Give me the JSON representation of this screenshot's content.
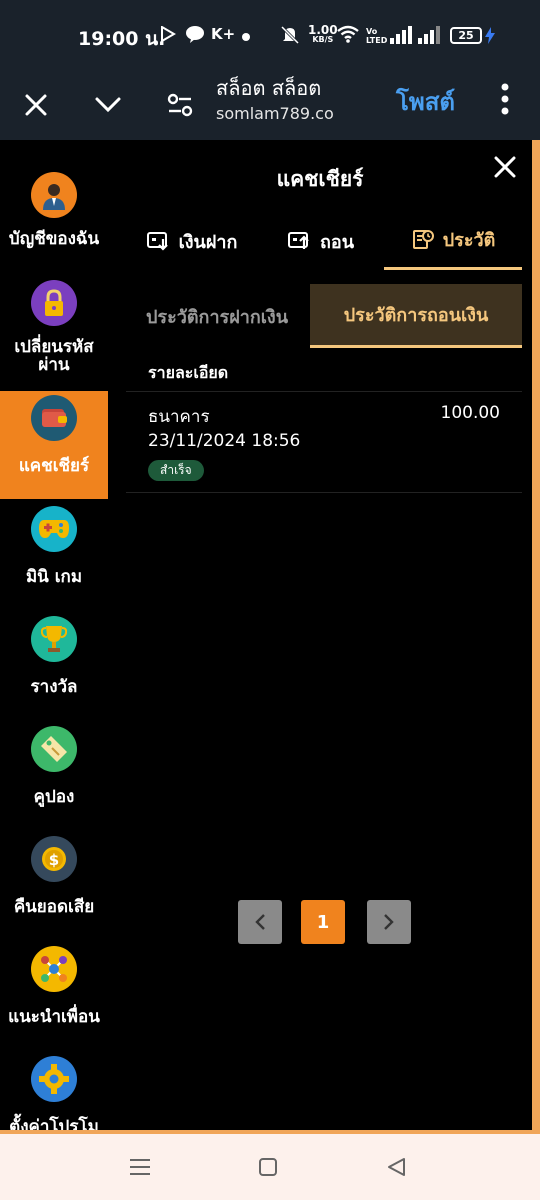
{
  "status_bar": {
    "time": "19:00 น.",
    "speed_value": "1.00",
    "speed_unit": "KB/S",
    "vo_top": "Vo",
    "vo_bottom": "LTED",
    "battery": "25",
    "k_plus": "K+"
  },
  "browser": {
    "title": "สล็อต สล็อต",
    "url": "somlam789.co",
    "post_label": "โพสต์"
  },
  "sidebar": {
    "items": [
      {
        "label": "บัญชีของฉัน",
        "icon": "user-icon",
        "color": "#f0831e"
      },
      {
        "label": "เปลี่ยนรหัสผ่าน",
        "icon": "lock-icon",
        "color": "#7b3fbf"
      },
      {
        "label": "แคชเชียร์",
        "icon": "wallet-icon",
        "color": "#1f5a73",
        "active": true
      },
      {
        "label": "มินิ เกม",
        "icon": "gamepad-icon",
        "color": "#17b3c9"
      },
      {
        "label": "รางวัล",
        "icon": "trophy-icon",
        "color": "#1fb89a"
      },
      {
        "label": "คูปอง",
        "icon": "coupon-icon",
        "color": "#3db86a"
      },
      {
        "label": "คืนยอดเสีย",
        "icon": "coin-icon",
        "color": "#35495c"
      },
      {
        "label": "แนะนำเพื่อน",
        "icon": "network-icon",
        "color": "#f4b800"
      },
      {
        "label": "ตั้งค่าโปรโม",
        "icon": "gear-icon",
        "color": "#2e7fd6"
      }
    ]
  },
  "panel": {
    "title": "แคชเชียร์",
    "tabs": [
      {
        "label": "เงินฝาก",
        "icon": "deposit-icon"
      },
      {
        "label": "ถอน",
        "icon": "withdraw-icon"
      },
      {
        "label": "ประวัติ",
        "icon": "history-icon",
        "active": true
      }
    ],
    "subtabs": {
      "deposit_history": "ประวัติการฝากเงิน",
      "withdraw_history": "ประวัติการถอนเงิน"
    },
    "table_header": "รายละเอียด",
    "rows": [
      {
        "bank": "ธนาคาร",
        "amount": "100.00",
        "date": "23/11/2024 18:56",
        "status": "สำเร็จ"
      }
    ],
    "pagination": {
      "current": "1"
    }
  },
  "colors": {
    "accent": "#f0831e",
    "gold": "#f5c77e",
    "link_blue": "#4a9ff0",
    "success_badge": "#1e5a3a"
  }
}
